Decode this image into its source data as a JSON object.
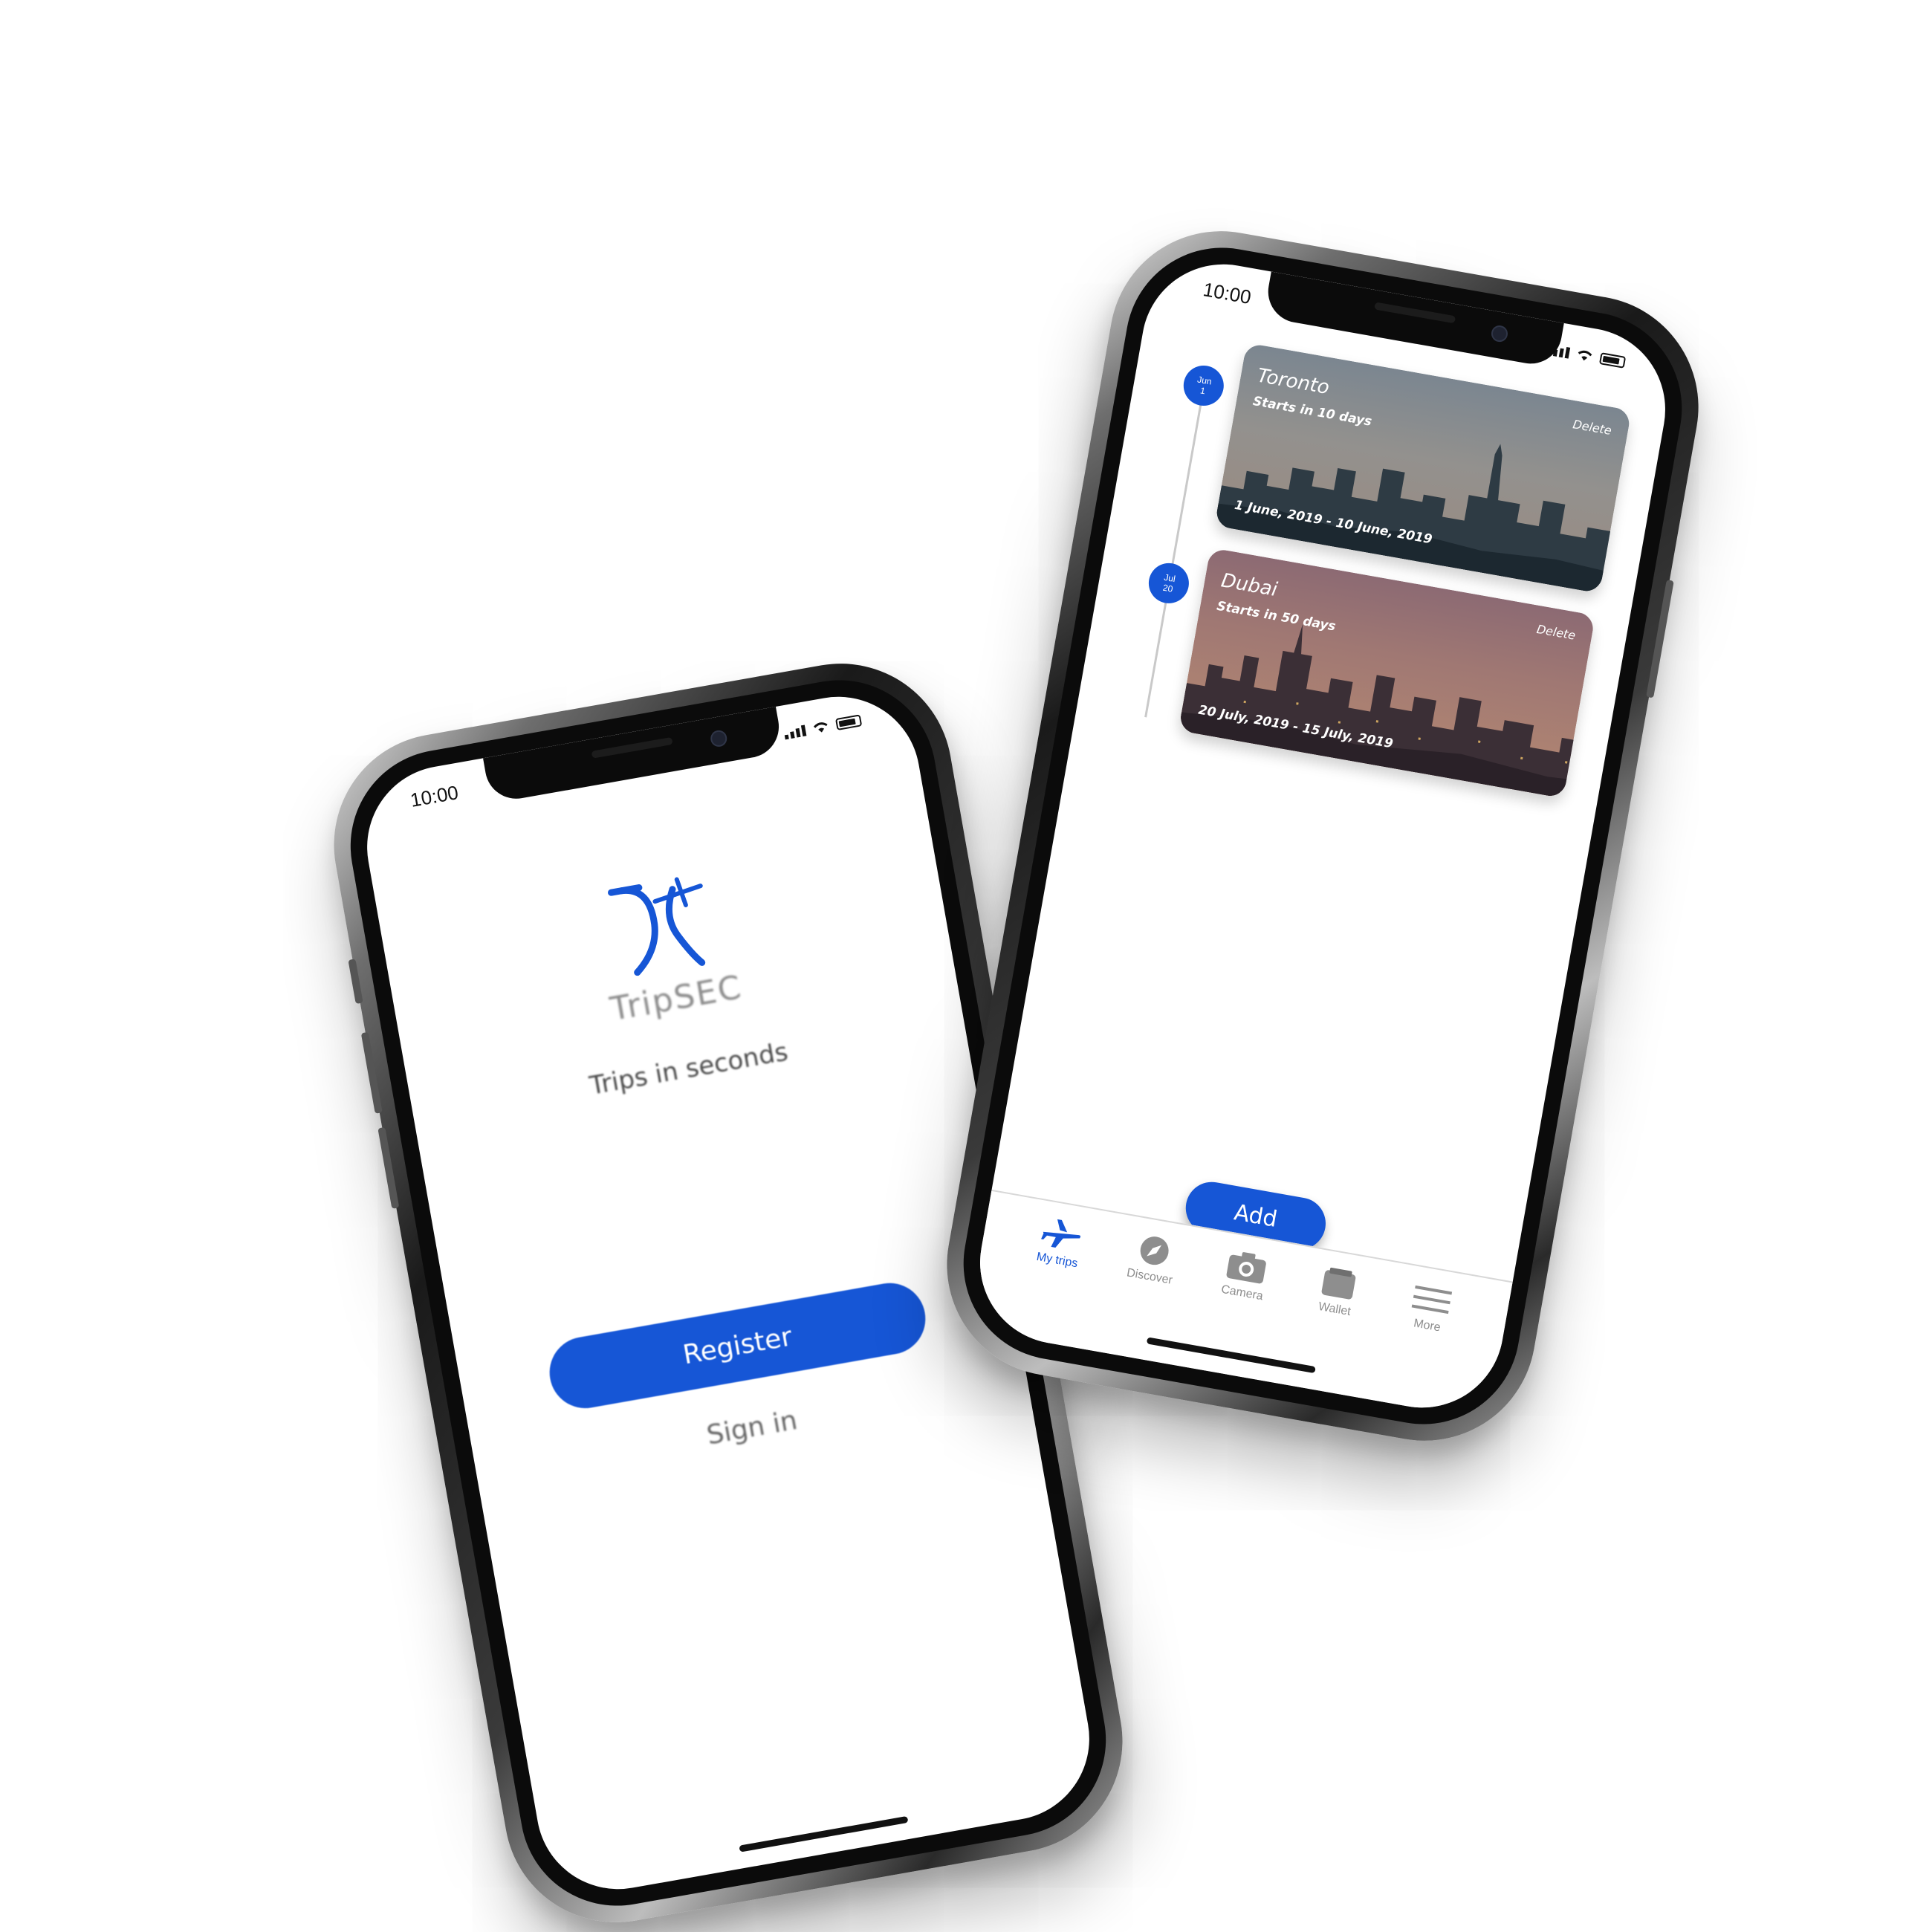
{
  "colors": {
    "accent": "#1656d6",
    "frame_dark": "#0b0b0b",
    "muted_text": "#8e8e8e",
    "background": "#ffffff"
  },
  "left_phone": {
    "status": {
      "time": "10:00"
    },
    "brand": {
      "name": "TripSEC",
      "logo_icon": "tripsec-logo-icon"
    },
    "tagline": "Trips in seconds",
    "register_label": "Register",
    "signin_label": "Sign in"
  },
  "right_phone": {
    "status": {
      "time": "10:00"
    },
    "trips": [
      {
        "badge_month": "Jun",
        "badge_day": "1",
        "city": "Toronto",
        "starts": "Starts in 10 days",
        "delete_label": "Delete",
        "range": "1 June, 2019 - 10 June, 2019"
      },
      {
        "badge_month": "Jul",
        "badge_day": "20",
        "city": "Dubai",
        "starts": "Starts in 50 days",
        "delete_label": "Delete",
        "range": "20 July, 2019 - 15 July, 2019"
      }
    ],
    "add_label": "Add",
    "tabs": [
      {
        "label": "My trips",
        "icon": "airplane-icon",
        "active": true
      },
      {
        "label": "Discover",
        "icon": "compass-icon",
        "active": false
      },
      {
        "label": "Camera",
        "icon": "camera-icon",
        "active": false
      },
      {
        "label": "Wallet",
        "icon": "wallet-icon",
        "active": false
      },
      {
        "label": "More",
        "icon": "menu-icon",
        "active": false
      }
    ]
  }
}
